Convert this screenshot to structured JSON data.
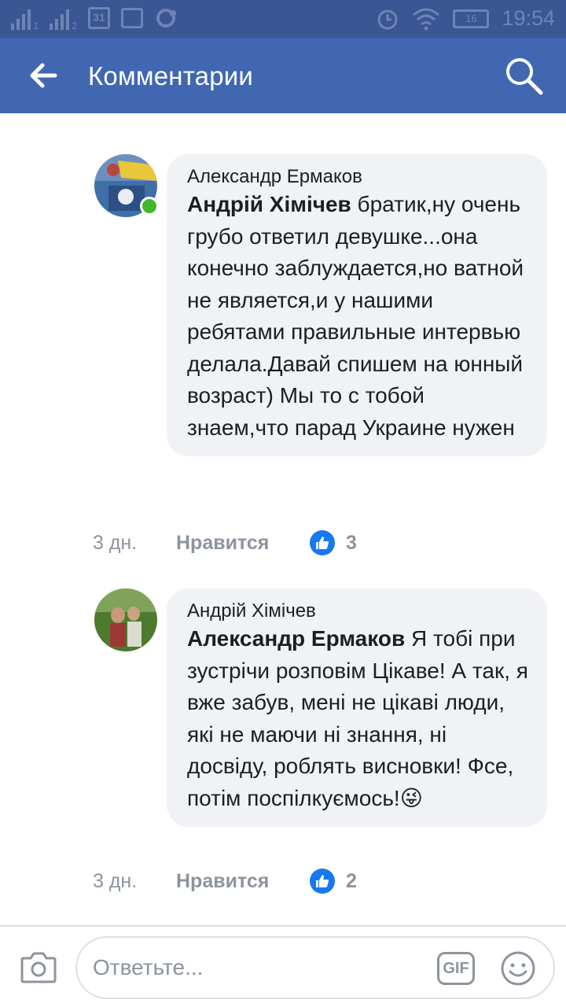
{
  "status_bar": {
    "sim1_label": "1",
    "sim2_label": "2",
    "calendar_day": "31",
    "battery_level": "16",
    "time": "19:54"
  },
  "app_bar": {
    "title": "Комментарии"
  },
  "comments": [
    {
      "author": "Александр Ермаков",
      "mention": "Андрій Хімічев",
      "text": " братик,ну очень грубо ответил девушке...она конечно заблуждается,но ватной не является,и у нашими ребятами правильные интервью делала.Давай спишем на юнный возраст) Мы то с тобой знаем,что парад Украине нужен",
      "time": "3 дн.",
      "like_label": "Нравится",
      "like_count": "3",
      "online": true
    },
    {
      "author": "Андрій Хімічев",
      "mention": "Александр Ермаков",
      "text": " Я тобі при зустрічи розповім Цікаве! А так, я вже забув, мені не цікаві люди, які не маючи ні знання, ні досвіду, роблять висновки! Фсе, потім поспілкуємось!😜",
      "time": "3 дн.",
      "like_label": "Нравится",
      "like_count": "2",
      "online": false
    }
  ],
  "reply_bar": {
    "placeholder": "Ответьте...",
    "gif_label": "GIF"
  },
  "colors": {
    "app_bar": "#4167b2",
    "status_bar": "#3a5693",
    "like_blue": "#1877f2",
    "online_green": "#42b72a",
    "bubble": "#f0f2f5"
  }
}
